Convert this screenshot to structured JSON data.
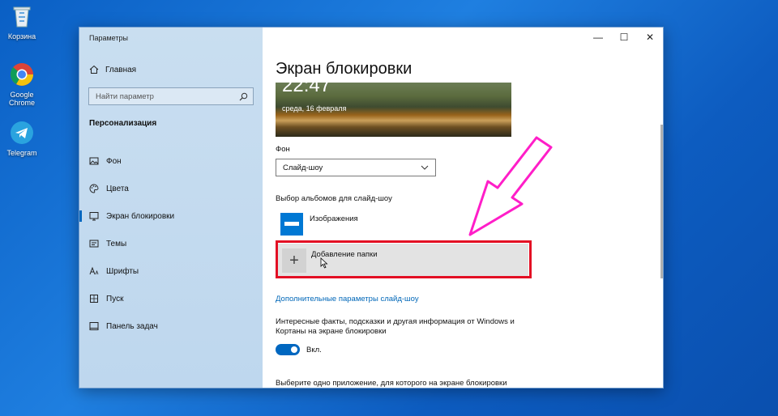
{
  "desktop": {
    "icons": [
      {
        "name": "recycle-bin",
        "label": "Корзина"
      },
      {
        "name": "google-chrome",
        "label_line1": "Google",
        "label_line2": "Chrome"
      },
      {
        "name": "telegram",
        "label": "Telegram"
      }
    ]
  },
  "window": {
    "title": "Параметры",
    "controls": {
      "minimize": "—",
      "maximize": "☐",
      "close": "✕"
    }
  },
  "sidebar": {
    "home": "Главная",
    "search_placeholder": "Найти параметр",
    "section": "Персонализация",
    "items": [
      {
        "label": "Фон",
        "icon": "image-icon"
      },
      {
        "label": "Цвета",
        "icon": "palette-icon"
      },
      {
        "label": "Экран блокировки",
        "icon": "lock-screen-icon",
        "active": true
      },
      {
        "label": "Темы",
        "icon": "themes-icon"
      },
      {
        "label": "Шрифты",
        "icon": "font-icon"
      },
      {
        "label": "Пуск",
        "icon": "start-icon"
      },
      {
        "label": "Панель задач",
        "icon": "taskbar-icon"
      }
    ]
  },
  "main": {
    "title": "Экран блокировки",
    "preview": {
      "time": "22:47",
      "date": "среда, 16 февраля"
    },
    "background_label": "Фон",
    "background_value": "Слайд-шоу",
    "albums_label": "Выбор альбомов для слайд-шоу",
    "album": "Изображения",
    "add_folder": "Добавление папки",
    "advanced_link": "Дополнительные параметры слайд-шоу",
    "fun_facts": "Интересные факты, подсказки и другая информация от Windows и Кортаны на экране блокировки",
    "toggle_state": "Вкл.",
    "toggle_on": true,
    "choose_app": "Выберите одно приложение, для которого на экране блокировки"
  },
  "colors": {
    "accent": "#0067c0",
    "highlight": "#e30f24",
    "annotation_arrow": "#ff1ec8"
  }
}
